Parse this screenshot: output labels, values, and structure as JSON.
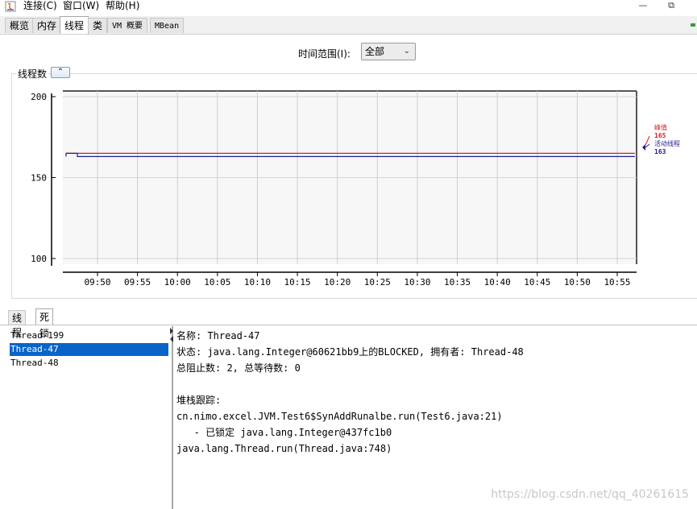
{
  "menu": {
    "items": [
      "连接(C)",
      "窗口(W)",
      "帮助(H)"
    ],
    "window_buttons": [
      "—",
      "⧉"
    ]
  },
  "tabs": [
    {
      "label": "概览",
      "active": false
    },
    {
      "label": "内存",
      "active": false
    },
    {
      "label": "线程",
      "active": true
    },
    {
      "label": "类",
      "active": false
    },
    {
      "label": "VM 概要",
      "active": false
    },
    {
      "label": "MBean",
      "active": false
    }
  ],
  "time_range": {
    "label": "时间范围(I):",
    "value": "全部",
    "arrow": "⌄"
  },
  "chart_panel": {
    "title": "线程数",
    "collapse_glyph": "⌃"
  },
  "chart_data": {
    "type": "line",
    "title": "",
    "ylim": [
      100,
      200
    ],
    "yticks": [
      "200",
      "150",
      "100"
    ],
    "x_ticks": [
      "09:50",
      "09:55",
      "10:00",
      "10:05",
      "10:10",
      "10:15",
      "10:20",
      "10:25",
      "10:30",
      "10:35",
      "10:40",
      "10:45",
      "10:50",
      "10:55"
    ],
    "series": [
      {
        "name": "峰值",
        "color": "#d32020",
        "values": [
          165,
          165,
          165,
          165,
          165,
          165,
          165,
          165,
          165,
          165,
          165,
          165,
          165,
          165,
          165
        ],
        "last_value": "165"
      },
      {
        "name": "活动线程",
        "color": "#20208c",
        "values": [
          165,
          163,
          163,
          163,
          163,
          163,
          163,
          163,
          163,
          163,
          163,
          163,
          163,
          163,
          163
        ],
        "last_value": "163"
      }
    ]
  },
  "subtabs": [
    {
      "label": "线程",
      "active": false
    },
    {
      "label": "死锁",
      "active": true
    }
  ],
  "threads": [
    {
      "name": "Thread-199",
      "selected": false
    },
    {
      "name": "Thread-47",
      "selected": true
    },
    {
      "name": "Thread-48",
      "selected": false
    }
  ],
  "details": {
    "lines": [
      "名称: Thread-47",
      "状态: java.lang.Integer@60621bb9上的BLOCKED, 拥有者: Thread-48",
      "总阻止数: 2, 总等待数: 0",
      "",
      "堆栈跟踪:",
      "cn.nimo.excel.JVM.Test6$SynAddRunalbe.run(Test6.java:21)",
      "   - 已锁定 java.lang.Integer@437fc1b0",
      "java.lang.Thread.run(Thread.java:748)"
    ]
  },
  "watermark": "https://blog.csdn.net/qq_40261615"
}
